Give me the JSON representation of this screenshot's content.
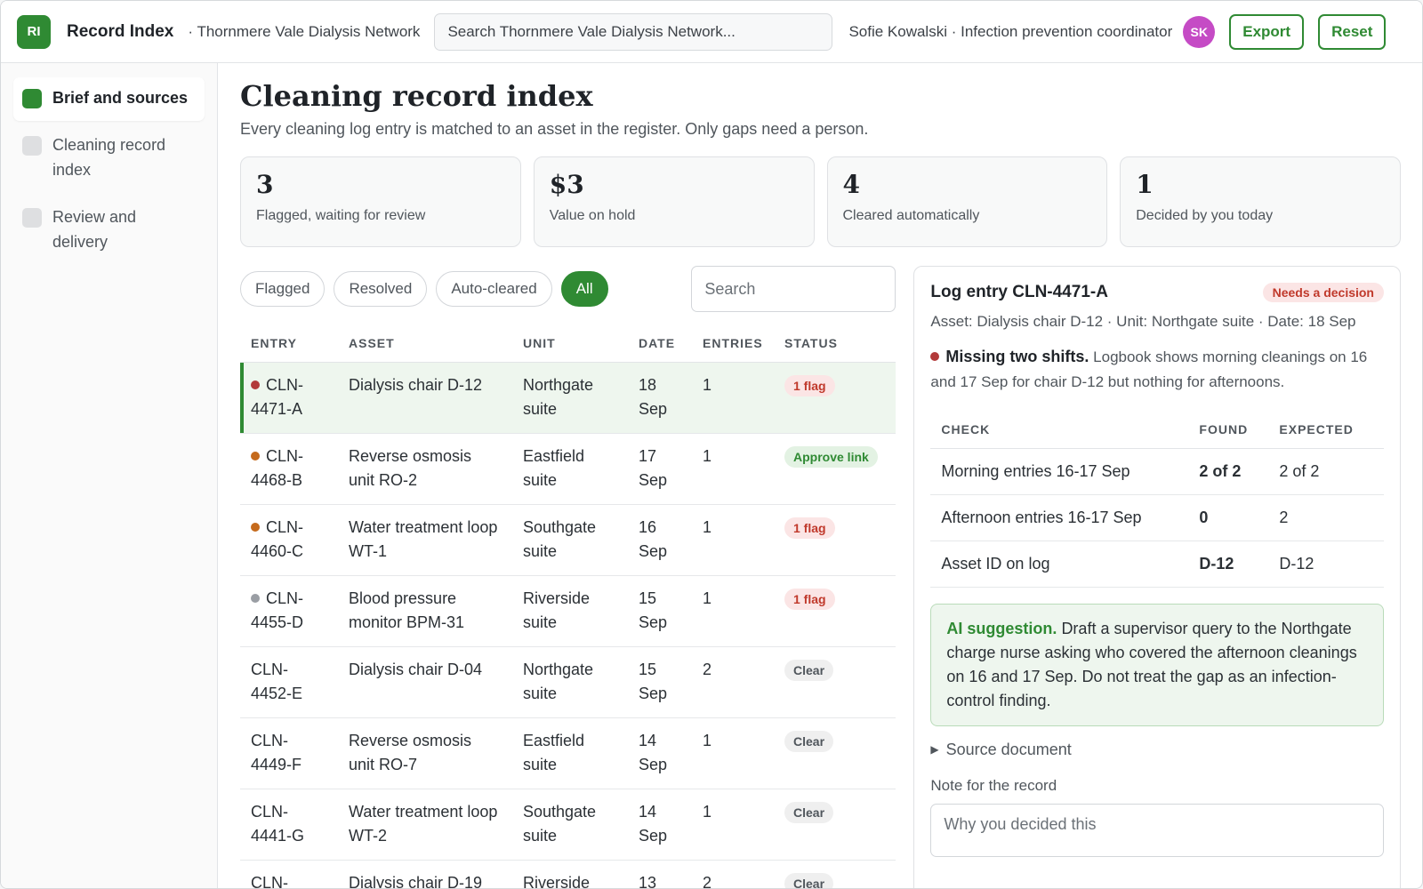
{
  "topbar": {
    "logo": "RI",
    "app_name": "Record Index",
    "org": "· Thornmere Vale Dialysis Network",
    "search_placeholder": "Search Thornmere Vale Dialysis Network...",
    "user": "Sofie Kowalski · Infection prevention coordinator",
    "avatar": "SK",
    "export_label": "Export",
    "reset_label": "Reset"
  },
  "sidebar": {
    "items": [
      {
        "label": "Brief and sources",
        "active": true
      },
      {
        "label": "Cleaning record index",
        "active": false
      },
      {
        "label": "Review and delivery",
        "active": false
      }
    ]
  },
  "main": {
    "title": "Cleaning record index",
    "subtitle": "Every cleaning log entry is matched to an asset in the register. Only gaps need a person.",
    "stats": [
      {
        "value": "3",
        "label": "Flagged, waiting for review"
      },
      {
        "value": "$3",
        "label": "Value on hold"
      },
      {
        "value": "4",
        "label": "Cleared automatically"
      },
      {
        "value": "1",
        "label": "Decided by you today"
      }
    ],
    "filters": [
      {
        "label": "Flagged",
        "active": false
      },
      {
        "label": "Resolved",
        "active": false
      },
      {
        "label": "Auto-cleared",
        "active": false
      },
      {
        "label": "All",
        "active": true
      }
    ],
    "list_search_placeholder": "Search",
    "columns": [
      "ENTRY",
      "ASSET",
      "UNIT",
      "DATE",
      "ENTRIES",
      "STATUS"
    ],
    "rows": [
      {
        "entry": "CLN-4471-A",
        "asset": "Dialysis chair D-12",
        "unit": "Northgate suite",
        "date": "18 Sep",
        "entries": "1",
        "status": "1 flag",
        "status_type": "flag",
        "dot": "#b23a3a",
        "selected": true
      },
      {
        "entry": "CLN-4468-B",
        "asset": "Reverse osmosis unit RO-2",
        "unit": "Eastfield suite",
        "date": "17 Sep",
        "entries": "1",
        "status": "Approve link",
        "status_type": "approve",
        "dot": "#c56a1c",
        "selected": false
      },
      {
        "entry": "CLN-4460-C",
        "asset": "Water treatment loop WT-1",
        "unit": "Southgate suite",
        "date": "16 Sep",
        "entries": "1",
        "status": "1 flag",
        "status_type": "flag",
        "dot": "#c56a1c",
        "selected": false
      },
      {
        "entry": "CLN-4455-D",
        "asset": "Blood pressure monitor BPM-31",
        "unit": "Riverside suite",
        "date": "15 Sep",
        "entries": "1",
        "status": "1 flag",
        "status_type": "flag",
        "dot": "#9a9ea4",
        "selected": false
      },
      {
        "entry": "CLN-4452-E",
        "asset": "Dialysis chair D-04",
        "unit": "Northgate suite",
        "date": "15 Sep",
        "entries": "2",
        "status": "Clear",
        "status_type": "clear",
        "dot": "",
        "selected": false
      },
      {
        "entry": "CLN-4449-F",
        "asset": "Reverse osmosis unit RO-7",
        "unit": "Eastfield suite",
        "date": "14 Sep",
        "entries": "1",
        "status": "Clear",
        "status_type": "clear",
        "dot": "",
        "selected": false
      },
      {
        "entry": "CLN-4441-G",
        "asset": "Water treatment loop WT-2",
        "unit": "Southgate suite",
        "date": "14 Sep",
        "entries": "1",
        "status": "Clear",
        "status_type": "clear",
        "dot": "",
        "selected": false
      },
      {
        "entry": "CLN-",
        "asset": "Dialysis chair D-19",
        "unit": "Riverside",
        "date": "13",
        "entries": "2",
        "status": "Clear",
        "status_type": "clear",
        "dot": "",
        "selected": false
      }
    ]
  },
  "panel": {
    "title": "Log entry CLN-4471-A",
    "badge": "Needs a decision",
    "meta": "Asset: Dialysis chair D-12 · Unit: Northgate suite · Date: 18 Sep",
    "finding_title": "Missing two shifts.",
    "finding_text": "Logbook shows morning cleanings on 16 and 17 Sep for chair D-12 but nothing for afternoons.",
    "check_columns": [
      "CHECK",
      "FOUND",
      "EXPECTED"
    ],
    "checks": [
      {
        "check": "Morning entries 16-17 Sep",
        "found": "2 of 2",
        "found_ok": true,
        "expected": "2 of 2"
      },
      {
        "check": "Afternoon entries 16-17 Sep",
        "found": "0",
        "found_ok": false,
        "expected": "2"
      },
      {
        "check": "Asset ID on log",
        "found": "D-12",
        "found_ok": true,
        "expected": "D-12"
      }
    ],
    "ai_label": "AI suggestion.",
    "ai_text": "Draft a supervisor query to the Northgate charge nurse asking who covered the afternoon cleanings on 16 and 17 Sep. Do not treat the gap as an infection-control finding.",
    "source_label": "Source document",
    "note_label": "Note for the record",
    "note_placeholder": "Why you decided this"
  },
  "colors": {
    "accent": "#2f8a33",
    "flag": "#c0392b"
  }
}
